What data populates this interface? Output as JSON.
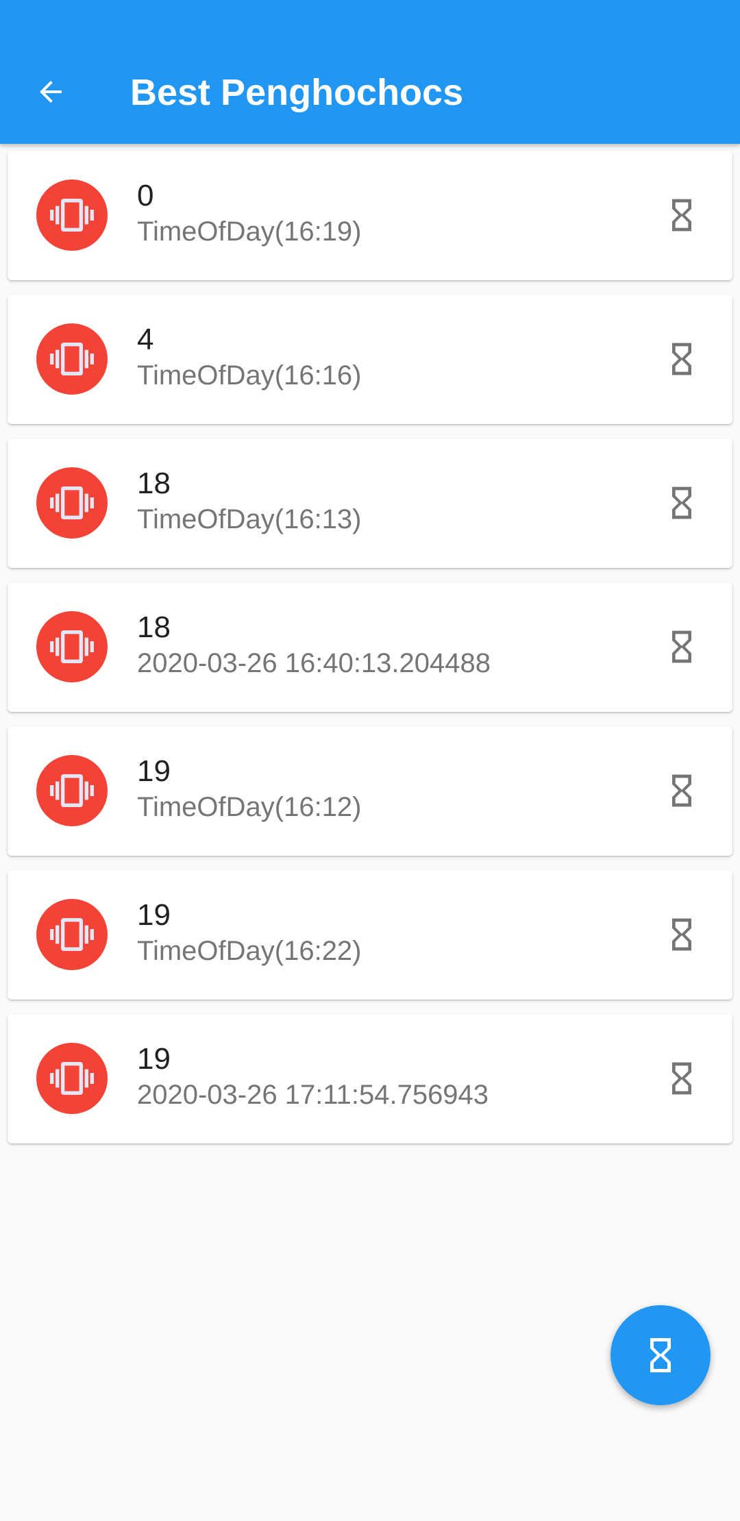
{
  "app_bar": {
    "title": "Best Penghochocs",
    "back_icon": "arrow-back-icon",
    "color": "#2196f3"
  },
  "items": [
    {
      "title": "0",
      "subtitle": "TimeOfDay(16:19)"
    },
    {
      "title": "4",
      "subtitle": "TimeOfDay(16:16)"
    },
    {
      "title": "18",
      "subtitle": "TimeOfDay(16:13)"
    },
    {
      "title": "18",
      "subtitle": "2020-03-26 16:40:13.204488"
    },
    {
      "title": "19",
      "subtitle": "TimeOfDay(16:12)"
    },
    {
      "title": "19",
      "subtitle": "TimeOfDay(16:22)"
    },
    {
      "title": "19",
      "subtitle": "2020-03-26 17:11:54.756943"
    }
  ],
  "icons": {
    "leading": "vibration-icon",
    "trailing": "hourglass-icon",
    "fab": "hourglass-icon"
  },
  "colors": {
    "avatar": "#f44336",
    "fab": "#2196f3",
    "background": "#fafafa"
  }
}
